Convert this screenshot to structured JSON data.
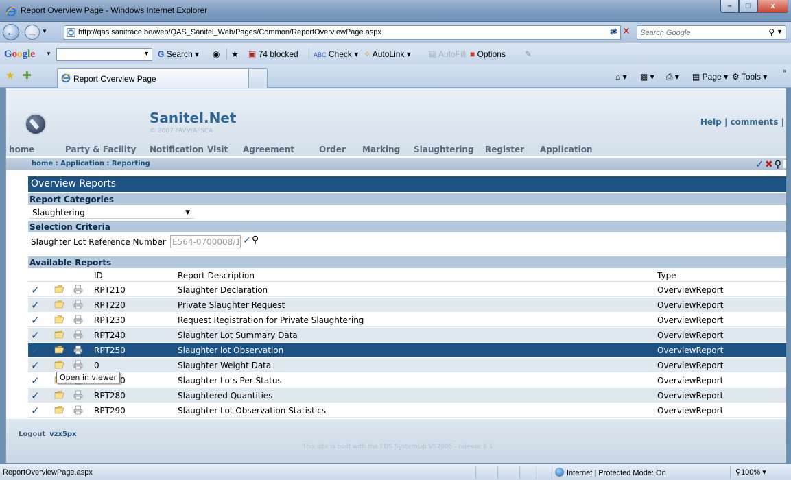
{
  "window": {
    "title": "Report Overview Page - Windows Internet Explorer",
    "minimize": "–",
    "maximize": "□",
    "close": "x"
  },
  "address_bar": {
    "url": "http://qas.sanitrace.be/web/QAS_Sanitel_Web/Pages/Common/ReportOverviewPage.aspx",
    "search_placeholder": "Search Google"
  },
  "google_toolbar": {
    "search_label": "Search",
    "blocked_label": "74 blocked",
    "check_label": "Check",
    "autolink_label": "AutoLink",
    "autofill_label": "AutoFill",
    "options_label": "Options"
  },
  "tabs": {
    "active_tab_label": "Report Overview Page"
  },
  "command_bar": {
    "page_label": "Page",
    "tools_label": "Tools"
  },
  "site": {
    "title": "Sanitel.Net",
    "copyright": "© 2007 FAVV/AFSCA",
    "help_links": "Help | comments |",
    "nav": [
      "home",
      "Party & Facility",
      "Notification",
      "Visit",
      "Agreement",
      "Order",
      "Marking",
      "Slaughtering",
      "Register",
      "Application"
    ],
    "breadcrumb": "home : Application : Reporting"
  },
  "panel": {
    "title": "Overview Reports",
    "report_categories_label": "Report Categories",
    "selected_category": "Slaughtering",
    "selection_criteria_label": "Selection Criteria",
    "criteria_field_label": "Slaughter Lot Reference Number",
    "criteria_field_value": "E564-0700008/1",
    "available_reports_label": "Available Reports"
  },
  "reports_table": {
    "columns": {
      "id": "ID",
      "description": "Report Description",
      "type": "Type"
    },
    "rows": [
      {
        "id": "RPT210",
        "description": "Slaughter Declaration",
        "type": "OverviewReport"
      },
      {
        "id": "RPT220",
        "description": "Private Slaughter Request",
        "type": "OverviewReport"
      },
      {
        "id": "RPT230",
        "description": "Request Registration for Private Slaughtering",
        "type": "OverviewReport"
      },
      {
        "id": "RPT240",
        "description": "Slaughter Lot Summary Data",
        "type": "OverviewReport"
      },
      {
        "id": "RPT250",
        "description": "Slaughter lot Observation",
        "type": "OverviewReport"
      },
      {
        "id": "0",
        "description": "Slaughter Weight Data",
        "type": "OverviewReport"
      },
      {
        "id": "RPT270",
        "description": "Slaughter Lots Per Status",
        "type": "OverviewReport"
      },
      {
        "id": "RPT280",
        "description": "Slaughtered Quantities",
        "type": "OverviewReport"
      },
      {
        "id": "RPT290",
        "description": "Slaughter Lot Observation Statistics",
        "type": "OverviewReport"
      }
    ],
    "selected_index": 4
  },
  "tooltip": "Open in viewer",
  "footer": {
    "logout_label": "Logout",
    "username": "vzx5px",
    "built_with": "This site is built with the EDS.SystemLib VS2005 - release 8.1"
  },
  "status_bar": {
    "text": "ReportOverviewPage.aspx",
    "zone": "Internet | Protected Mode: On",
    "zoom": "100%"
  },
  "colors": {
    "header_blue": "#1c5284",
    "section_bar": "#b5c9dd",
    "row_alt": "#dfe7ef",
    "site_title": "#2f6695"
  }
}
